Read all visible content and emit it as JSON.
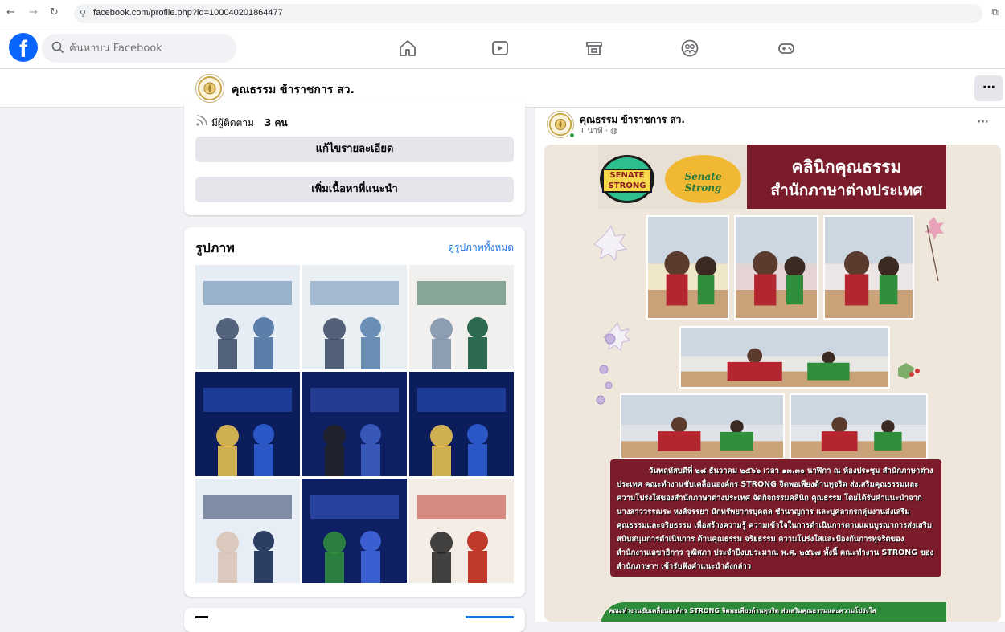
{
  "browser": {
    "url": "facebook.com/profile.php?id=100040201864477"
  },
  "header": {
    "logo_text": "f",
    "search_placeholder": "ค้นหาบน Facebook",
    "nav_icons": [
      "home-icon",
      "video-icon",
      "marketplace-icon",
      "groups-icon",
      "gaming-icon"
    ]
  },
  "profile": {
    "name": "คุณธรรม ข้าราชการ สว.",
    "followers_prefix": "มีผู้ติดตาม",
    "followers_count": "3 คน",
    "edit_details_button": "แก้ไขรายละเอียด",
    "add_featured_button": "เพิ่มเนื้อหาที่แนะนำ"
  },
  "photos": {
    "title": "รูปภาพ",
    "see_all": "ดูรูปภาพทั้งหมด",
    "count": 9
  },
  "post": {
    "author": "คุณธรรม ข้าราชการ สว.",
    "time": "1 นาที ·",
    "poster": {
      "logo1": "SENATE STRONG",
      "logo2": "Senate Strong",
      "title_line1": "คลินิกคุณธรรม",
      "title_line2": "สำนักภาษาต่างประเทศ",
      "body": "วันพฤหัสบดีที่ ๒๘ ธันวาคม ๒๕๖๖ เวลา ๑๓.๓๐ นาฬิกา ณ ห้องประชุม สำนักภาษาต่างประเทศ คณะทำงานขับเคลื่อนองค์กร STRONG จิตพอเพียงต้านทุจริต ส่งเสริมคุณธรรมและความโปร่งใสของสำนักภาษาต่างประเทศ จัดกิจกรรมคลินิก คุณธรรม โดยได้รับคำแนะนำจากนางสาววรรณระ หงส์จรรยา นักทรัพยากรบุคคล ชำนาญการ และบุคลากรกลุ่มงานส่งเสริมคุณธรรมและจริยธรรม เพื่อสร้างความรู้ ความเข้าใจในการดำเนินการตามแผนบูรณาการส่งเสริม สนับสนุนการดำเนินการ ด้านคุณธรรม จริยธรรม ความโปร่งใสและป้องกันการทุจริตของสำนักงานเลขาธิการ วุฒิสภา ประจำปีงบประมาณ พ.ศ. ๒๕๖๗ ทั้งนี้ คณะทำงาน STRONG ของสำนักภาษาฯ เข้ารับฟังคำแนะนำดังกล่าว",
      "footer": "คณะทำงานขับเคลื่อนองค์กร STRONG จิตพอเพียงต้านทุจริต ส่งเสริมคุณธรรมและความโปร่งใส"
    }
  },
  "colors": {
    "fb_blue": "#0866ff",
    "maroon": "#7a1c2a",
    "link": "#1b74e4"
  }
}
